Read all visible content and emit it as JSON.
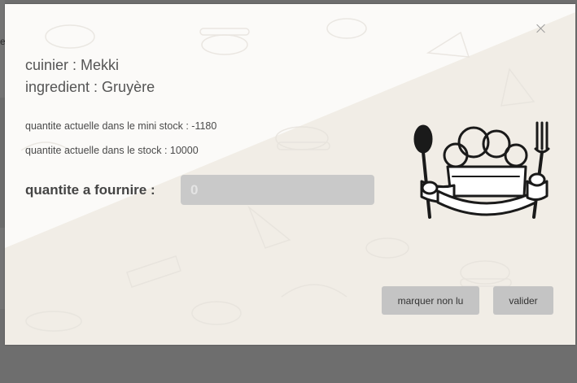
{
  "behind": {
    "edge_text": "e"
  },
  "modal": {
    "close_icon": "close-icon",
    "cook_line": "cuinier : Mekki",
    "ingredient_line": "ingredient : Gruyère",
    "mini_stock_line": "quantite actuelle dans le mini stock : -1180",
    "stock_line": "quantite actuelle dans le stock : 10000",
    "quantity_label": "quantite a fournire :",
    "quantity_input": {
      "value": "",
      "placeholder": "0"
    },
    "logo_icon": "chef-hat-spoon-fork-icon",
    "buttons": {
      "mark_unread": "marquer non lu",
      "validate": "valider"
    }
  },
  "colors": {
    "backdrop": "#6e6e6e",
    "modal_light": "#faf9f7",
    "modal_beige": "#f2eee8",
    "button_bg": "#c4c4c4",
    "input_bg": "#c9c9c9"
  }
}
